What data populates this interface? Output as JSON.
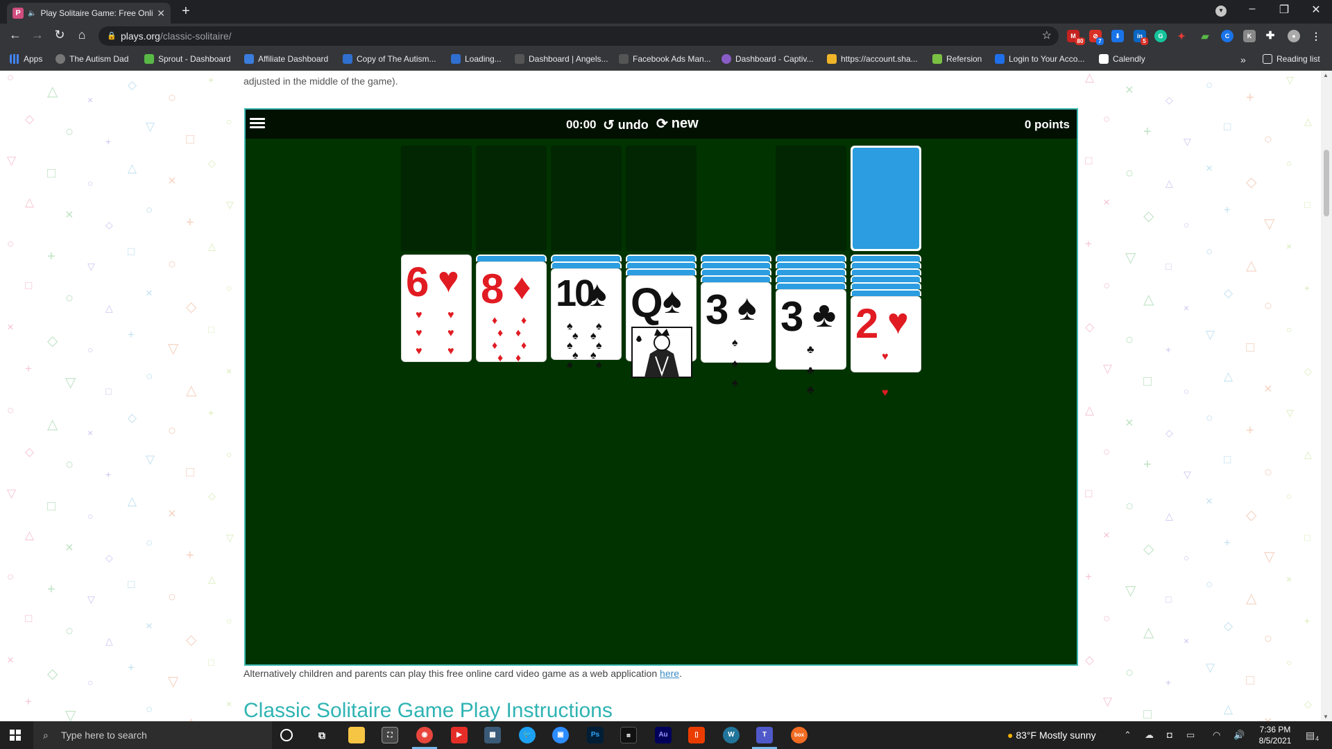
{
  "browser": {
    "tab_title": "Play Solitaire Game: Free Onli",
    "url_domain": "plays.org",
    "url_path": "/classic-solitaire/",
    "bookmarks": [
      {
        "label": "Apps",
        "color": "#4285f4"
      },
      {
        "label": "The Autism Dad",
        "color": "#888888"
      },
      {
        "label": "Sprout - Dashboard",
        "color": "#59b947"
      },
      {
        "label": "Affiliate Dashboard",
        "color": "#3b7ddd"
      },
      {
        "label": "Copy of The Autism...",
        "color": "#2f6fcf"
      },
      {
        "label": "Loading...",
        "color": "#2f6fcf"
      },
      {
        "label": "Dashboard | Angels...",
        "color": "#666666"
      },
      {
        "label": "Facebook Ads Man...",
        "color": "#666666"
      },
      {
        "label": "Dashboard - Captiv...",
        "color": "#8a5cc7"
      },
      {
        "label": "https://account.sha...",
        "color": "#f0b429"
      },
      {
        "label": "Refersion",
        "color": "#7ac143"
      },
      {
        "label": "Login to Your Acco...",
        "color": "#1f6feb"
      },
      {
        "label": "Calendly",
        "color": "#ffffff"
      }
    ],
    "bookmarks_more": "»",
    "reading_list": "Reading list",
    "extension_badges": [
      "80",
      "7",
      "5"
    ]
  },
  "page": {
    "intro_text": "adjusted in the middle of the game).",
    "after_text": "Alternatively children and parents can play this free online card video game as a web application ",
    "after_link": "here",
    "after_end": ".",
    "heading": "Classic Solitaire Game Play Instructions"
  },
  "game": {
    "timer": "00:00",
    "undo_label": "undo",
    "new_label": "new",
    "points": "0 points",
    "tableau": [
      {
        "rank": "6",
        "suit": "♥",
        "color": "red",
        "hidden": 0
      },
      {
        "rank": "8",
        "suit": "♦",
        "color": "red",
        "hidden": 1
      },
      {
        "rank": "10",
        "suit": "♠",
        "color": "blk",
        "hidden": 2
      },
      {
        "rank": "Q",
        "suit": "♠",
        "color": "blk",
        "hidden": 3
      },
      {
        "rank": "3",
        "suit": "♠",
        "color": "blk",
        "hidden": 4
      },
      {
        "rank": "3",
        "suit": "♣",
        "color": "blk",
        "hidden": 5
      },
      {
        "rank": "2",
        "suit": "♥",
        "color": "red",
        "hidden": 6
      }
    ]
  },
  "taskbar": {
    "search_placeholder": "Type here to search",
    "weather": "83°F  Mostly sunny",
    "time": "7:36 PM",
    "date": "8/5/2021",
    "notification_count": "4"
  }
}
